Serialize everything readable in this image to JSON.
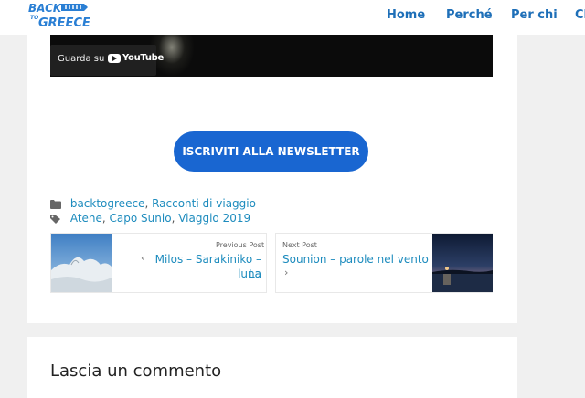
{
  "header": {
    "logo_top": "BACK",
    "logo_mid": "TO",
    "logo_bottom": "GREECE",
    "nav": [
      "Home",
      "Perché",
      "Per chi",
      "Cl"
    ]
  },
  "video": {
    "watch_on": "Guarda su",
    "platform": "YouTube"
  },
  "newsletter": {
    "label": "ISCRIVITI ALLA NEWSLETTER"
  },
  "meta": {
    "categories_icon": "folder-icon",
    "tags_icon": "tag-icon",
    "categories": [
      "backtogreece",
      "Racconti di viaggio"
    ],
    "tags": [
      "Atene",
      "Capo Sunio",
      "Viaggio 2019"
    ]
  },
  "post_nav": {
    "previous": {
      "label": "Previous Post",
      "title_line1": "Milos – Sarakiniko – La",
      "title_line2": "luna"
    },
    "next": {
      "label": "Next Post",
      "title": "Sounion – parole nel vento"
    }
  },
  "comments": {
    "title": "Lascia un commento"
  },
  "colors": {
    "link": "#1e8cbe",
    "nav": "#1e6fb8",
    "button": "#1966d1",
    "background": "#f0f0f0"
  }
}
